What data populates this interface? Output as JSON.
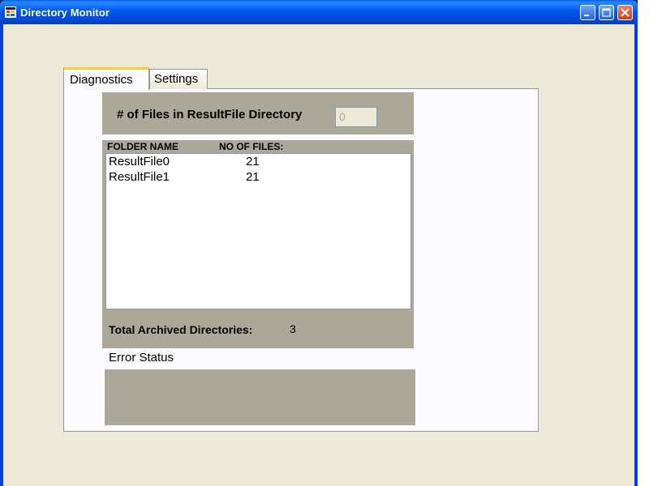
{
  "window": {
    "title": "Directory Monitor"
  },
  "tabs": [
    {
      "label": "Diagnostics",
      "active": true
    },
    {
      "label": "Settings",
      "active": false
    }
  ],
  "diagnostics": {
    "files_label": "# of Files in ResultFile Directory",
    "files_value": "0",
    "columns": {
      "folder_name": "FOLDER NAME",
      "file_count": "NO OF FILES:"
    },
    "folders": [
      {
        "name": "ResultFile0",
        "count": "21"
      },
      {
        "name": "ResultFile1",
        "count": "21"
      }
    ],
    "total_label": "Total Archived Directories:",
    "total_value": "3",
    "error_label": "Error Status",
    "error_text": ""
  },
  "colors": {
    "titlebar": "#0058ee",
    "window_bg": "#ece9d8",
    "group_bg": "#aca899",
    "tab_highlight": "#ffc83c"
  }
}
